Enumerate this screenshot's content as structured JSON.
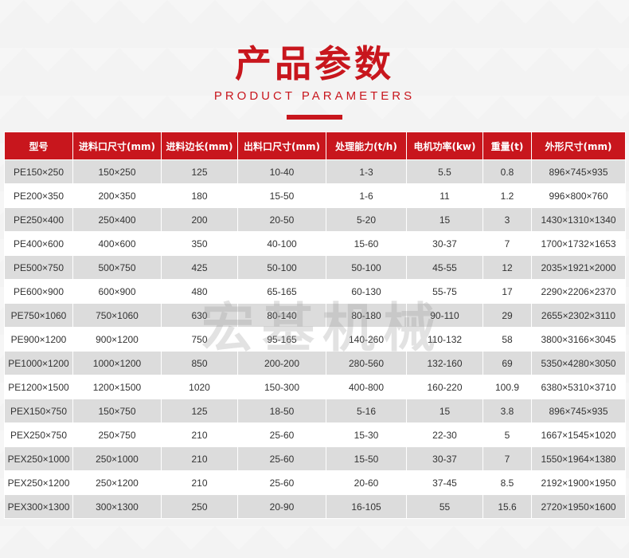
{
  "header": {
    "title": "产品参数",
    "subtitle": "PRODUCT PARAMETERS"
  },
  "watermark": "宏基机械",
  "colors": {
    "accent": "#c8161d",
    "row_alt": "#dcdcdc"
  },
  "table": {
    "columns": [
      "型号",
      "进料口尺寸(mm)",
      "进料边长(mm)",
      "出料口尺寸(mm)",
      "处理能力(t/h)",
      "电机功率(kw)",
      "重量(t)",
      "外形尺寸(mm)"
    ],
    "rows": [
      [
        "PE150×250",
        "150×250",
        "125",
        "10-40",
        "1-3",
        "5.5",
        "0.8",
        "896×745×935"
      ],
      [
        "PE200×350",
        "200×350",
        "180",
        "15-50",
        "1-6",
        "11",
        "1.2",
        "996×800×760"
      ],
      [
        "PE250×400",
        "250×400",
        "200",
        "20-50",
        "5-20",
        "15",
        "3",
        "1430×1310×1340"
      ],
      [
        "PE400×600",
        "400×600",
        "350",
        "40-100",
        "15-60",
        "30-37",
        "7",
        "1700×1732×1653"
      ],
      [
        "PE500×750",
        "500×750",
        "425",
        "50-100",
        "50-100",
        "45-55",
        "12",
        "2035×1921×2000"
      ],
      [
        "PE600×900",
        "600×900",
        "480",
        "65-165",
        "60-130",
        "55-75",
        "17",
        "2290×2206×2370"
      ],
      [
        "PE750×1060",
        "750×1060",
        "630",
        "80-140",
        "80-180",
        "90-110",
        "29",
        "2655×2302×3110"
      ],
      [
        "PE900×1200",
        "900×1200",
        "750",
        "95-165",
        "140-260",
        "110-132",
        "58",
        "3800×3166×3045"
      ],
      [
        "PE1000×1200",
        "1000×1200",
        "850",
        "200-200",
        "280-560",
        "132-160",
        "69",
        "5350×4280×3050"
      ],
      [
        "PE1200×1500",
        "1200×1500",
        "1020",
        "150-300",
        "400-800",
        "160-220",
        "100.9",
        "6380×5310×3710"
      ],
      [
        "PEX150×750",
        "150×750",
        "125",
        "18-50",
        "5-16",
        "15",
        "3.8",
        "896×745×935"
      ],
      [
        "PEX250×750",
        "250×750",
        "210",
        "25-60",
        "15-30",
        "22-30",
        "5",
        "1667×1545×1020"
      ],
      [
        "PEX250×1000",
        "250×1000",
        "210",
        "25-60",
        "15-50",
        "30-37",
        "7",
        "1550×1964×1380"
      ],
      [
        "PEX250×1200",
        "250×1200",
        "210",
        "25-60",
        "20-60",
        "37-45",
        "8.5",
        "2192×1900×1950"
      ],
      [
        "PEX300×1300",
        "300×1300",
        "250",
        "20-90",
        "16-105",
        "55",
        "15.6",
        "2720×1950×1600"
      ]
    ]
  }
}
